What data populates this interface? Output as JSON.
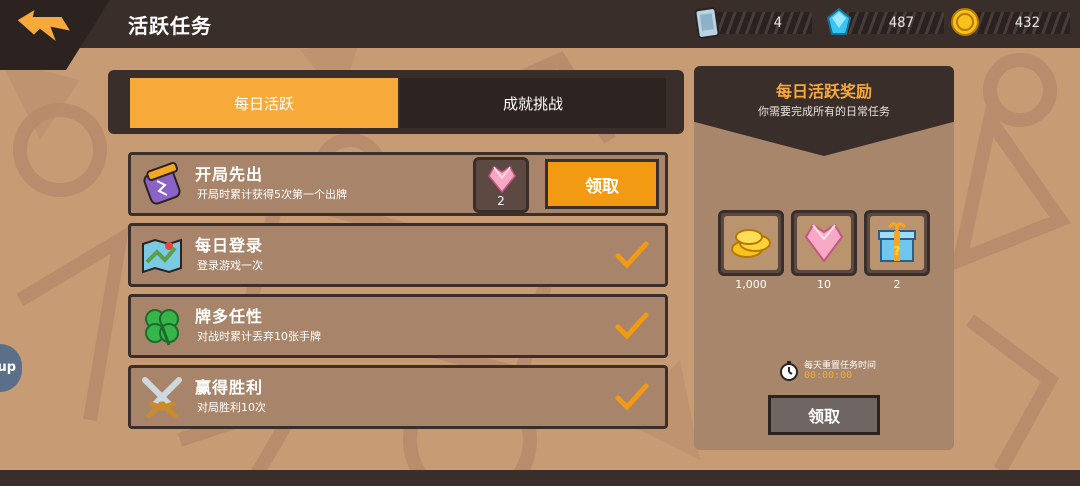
{
  "header": {
    "title": "活跃任务"
  },
  "currencies": [
    {
      "name": "cards",
      "value": "4"
    },
    {
      "name": "gems",
      "value": "487"
    },
    {
      "name": "coins",
      "value": "432"
    }
  ],
  "tabs": [
    {
      "label": "每日活跃",
      "active": true
    },
    {
      "label": "成就挑战",
      "active": false
    }
  ],
  "tasks": [
    {
      "title": "开局先出",
      "desc": "开局时累计获得5次第一个出牌",
      "reward_count": "2",
      "claim_label": "领取",
      "status": "claimable"
    },
    {
      "title": "每日登录",
      "desc": "登录游戏一次",
      "status": "done"
    },
    {
      "title": "牌多任性",
      "desc": "对战时累计丢弃10张手牌",
      "status": "done"
    },
    {
      "title": "赢得胜利",
      "desc": "对局胜利10次",
      "status": "done"
    }
  ],
  "panel": {
    "title": "每日活跃奖励",
    "subtitle": "你需要完成所有的日常任务",
    "rewards": [
      {
        "icon": "coins-icon",
        "count": "1,000"
      },
      {
        "icon": "heart-crystal-icon",
        "count": "10"
      },
      {
        "icon": "mystery-box-icon",
        "count": "2"
      }
    ],
    "reset_label": "每天重置任务时间",
    "reset_time": "00:00:00",
    "claim_label": "领取"
  },
  "side_tab": {
    "label": "up"
  },
  "colors": {
    "accent": "#f7a93a",
    "dark": "#3a2e2b",
    "panel": "#a8866b",
    "background": "#c79b74"
  }
}
